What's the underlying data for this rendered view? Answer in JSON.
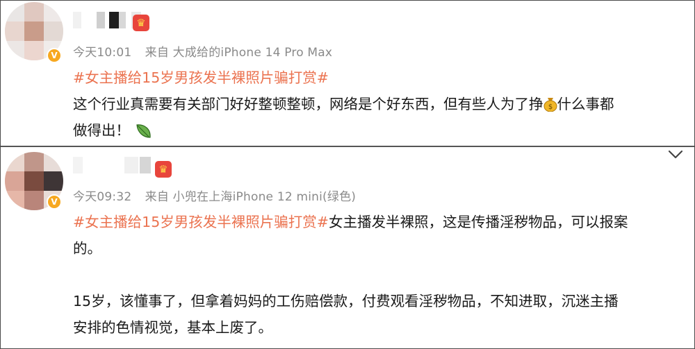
{
  "posts": [
    {
      "username": "",
      "timestamp": "今天10:01",
      "source": "来自 大成给的iPhone 14 Pro Max",
      "hashtag": "#女主播给15岁男孩发半裸照片骗打赏#",
      "body_lines": [
        "这个行业真需要有关部门好好整顿整顿，网络是个好东西，但有些人为了挣",
        "什么事都",
        "做得出！"
      ],
      "emojis": [
        "money-bag-icon",
        "leaf-icon"
      ]
    },
    {
      "username": "",
      "timestamp": "今天09:32",
      "source": "来自 小兜在上海iPhone 12 mini(绿色)",
      "hashtag": "#女主播给15岁男孩发半裸照片骗打赏#",
      "body_lines": [
        "女主播发半裸照，这是传播淫秽物品，可以报案",
        "的。",
        "15岁，该懂事了，但拿着妈妈的工伤赔偿款，付费观看淫秽物品，不知进取，沉迷主播",
        "安排的色情视觉，基本上废了。"
      ]
    }
  ],
  "colors": {
    "hashtag": "#eb7350",
    "meta": "#8a8a8a",
    "verified_badge": "#f7a820",
    "crown_badge": "#e8453c"
  }
}
